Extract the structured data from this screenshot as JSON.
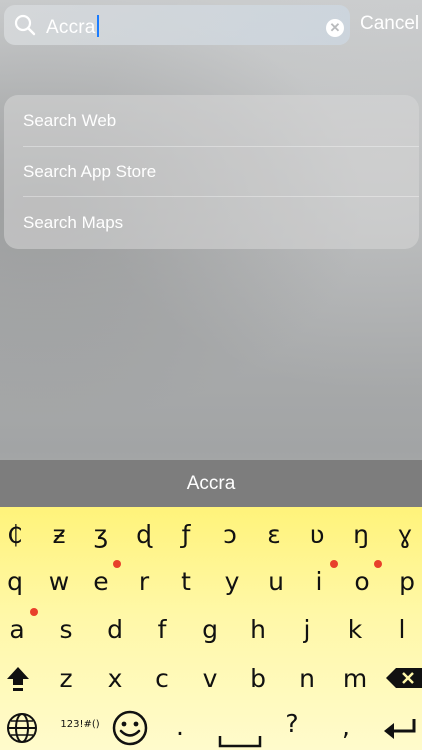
{
  "search": {
    "query": "Accra",
    "cancel_label": "Cancel"
  },
  "suggestions": [
    "Search Web",
    "Search App Store",
    "Search Maps"
  ],
  "prediction": "Accra",
  "keyboard": {
    "row1": [
      "₵",
      "ƶ",
      "ʒ",
      "ɖ",
      "ƒ",
      "ɔ",
      "ɛ",
      "ʋ",
      "ŋ",
      "ɣ"
    ],
    "row2": [
      "q",
      "w",
      "e",
      "r",
      "t",
      "y",
      "u",
      "i",
      "o",
      "p"
    ],
    "row3": [
      "a",
      "s",
      "d",
      "f",
      "g",
      "h",
      "j",
      "k",
      "l"
    ],
    "row4": [
      "z",
      "x",
      "c",
      "v",
      "b",
      "n",
      "m"
    ],
    "numbers_label": "123!#()",
    "punct1": ".",
    "punct2": "?",
    "punct3": ",",
    "accent_color": "#e8402b",
    "keyboard_color_top": "#fff37a",
    "keyboard_color_bottom": "#fffbcc"
  }
}
